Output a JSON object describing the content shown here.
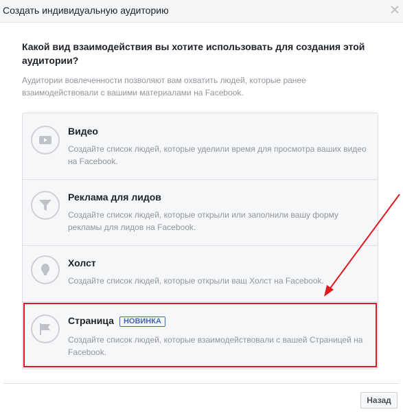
{
  "dialog": {
    "title": "Создать индивидуальную аудиторию",
    "question": "Какой вид взаимодействия вы хотите использовать для создания этой аудитории?",
    "description": "Аудитории вовлеченности позволяют вам охватить людей, которые ранее взаимодействовали с вашими материалами на Facebook."
  },
  "options": [
    {
      "title": "Видео",
      "description": "Создайте список людей, которые уделили время для просмотра ваших видео на Facebook.",
      "icon": "video-play-icon"
    },
    {
      "title": "Реклама для лидов",
      "description": "Создайте список людей, которые открыли или заполнили вашу форму рекламы для лидов на Facebook.",
      "icon": "funnel-icon"
    },
    {
      "title": "Холст",
      "description": "Создайте список людей, которые открыли ваш Холст на Facebook.",
      "icon": "balloon-icon"
    },
    {
      "title": "Страница",
      "badge": "НОВИНКА",
      "description": "Создайте список людей, которые взаимодействовали с вашей Страницей на Facebook.",
      "icon": "flag-icon"
    }
  ],
  "footer": {
    "back_label": "Назад"
  },
  "colors": {
    "accent": "#4267b2",
    "highlight": "#e0181f",
    "icon_gray": "#ced0d4"
  }
}
